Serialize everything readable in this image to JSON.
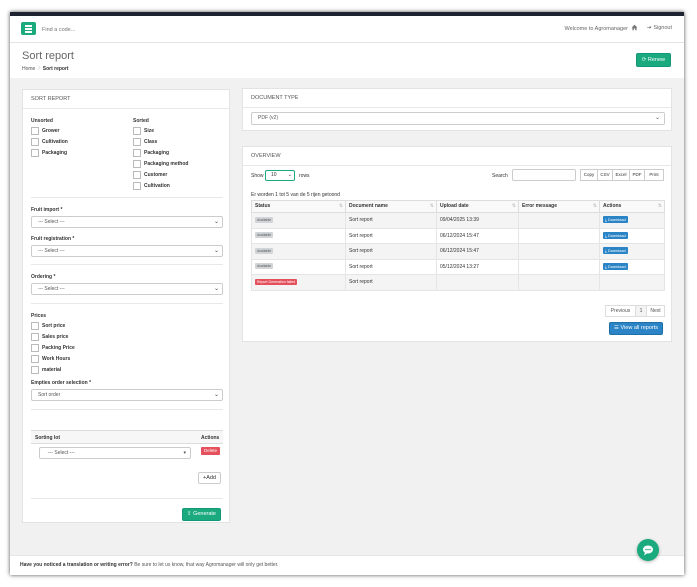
{
  "topbar": {
    "search_placeholder": "Find a code...",
    "welcome": "Welcome to Agromanager",
    "signout": "Signout"
  },
  "header": {
    "title": "Sort report",
    "breadcrumb": [
      "Home",
      "Sort report"
    ],
    "renew_label": "Renew"
  },
  "sort_report": {
    "title": "SORT REPORT",
    "unsorted_title": "Unsorted",
    "unsorted": [
      "Grower",
      "Cultivation",
      "Packaging"
    ],
    "sorted_title": "Sorted",
    "sorted": [
      "Size",
      "Class",
      "Packaging",
      "Packaging method",
      "Customer",
      "Cultivation"
    ],
    "fruit_import_label": "Fruit import *",
    "fruit_import_value": "--- Select ---",
    "fruit_registration_label": "Fruit registration *",
    "fruit_registration_value": "--- Select ---",
    "ordering_label": "Ordering *",
    "ordering_value": "--- Select ---",
    "prices_label": "Prices",
    "prices": [
      "Sort price",
      "Sales price",
      "Packing Price",
      "Work Hours",
      "material"
    ],
    "empties_label": "Empties order selection *",
    "empties_value": "Sort order",
    "sorting_lot_header": "Sorting lot",
    "actions_header": "Actions",
    "sorting_lot_value": "--- Select ---",
    "delete_label": "Delete",
    "add_label": "Add",
    "generate_label": "Generate"
  },
  "document_type": {
    "title": "DOCUMENT TYPE",
    "value": "PDF (v2)"
  },
  "overview": {
    "title": "OVERVIEW",
    "show_label": "Show",
    "show_value": "10",
    "rows_label": "rows",
    "search_label": "Search",
    "export_buttons": [
      "Copy",
      "CSV",
      "Excel",
      "PDF",
      "Print"
    ],
    "info": "Er worden 1 tot 5 van de 5 rijen getoond",
    "columns": [
      "Status",
      "Document name",
      "Upload date",
      "Error message",
      "Actions"
    ],
    "rows": [
      {
        "status": "Available",
        "status_type": "available",
        "name": "Sort report",
        "date": "09/04/2025 13:39",
        "error": "",
        "action": "Download"
      },
      {
        "status": "Available",
        "status_type": "available",
        "name": "Sort report",
        "date": "06/12/2024 15:47",
        "error": "",
        "action": "Download"
      },
      {
        "status": "Available",
        "status_type": "available",
        "name": "Sort report",
        "date": "06/12/2024 15:47",
        "error": "",
        "action": "Download"
      },
      {
        "status": "Available",
        "status_type": "available",
        "name": "Sort report",
        "date": "05/12/2024 13:27",
        "error": "",
        "action": "Download"
      },
      {
        "status": "Report Generation failed",
        "status_type": "failed",
        "name": "Sort report",
        "date": "",
        "error": "",
        "action": ""
      }
    ],
    "pagination": {
      "previous": "Previous",
      "page": "1",
      "next": "Next"
    },
    "view_all_label": "View all reports"
  },
  "footer": {
    "question": "Have you noticed a translation or writing error?",
    "text": " Be sure to let us know, that way Agromanager will only get better."
  },
  "colors": {
    "brand": "#1aaa7e",
    "primary": "#2a84c6",
    "danger": "#e4515d"
  }
}
